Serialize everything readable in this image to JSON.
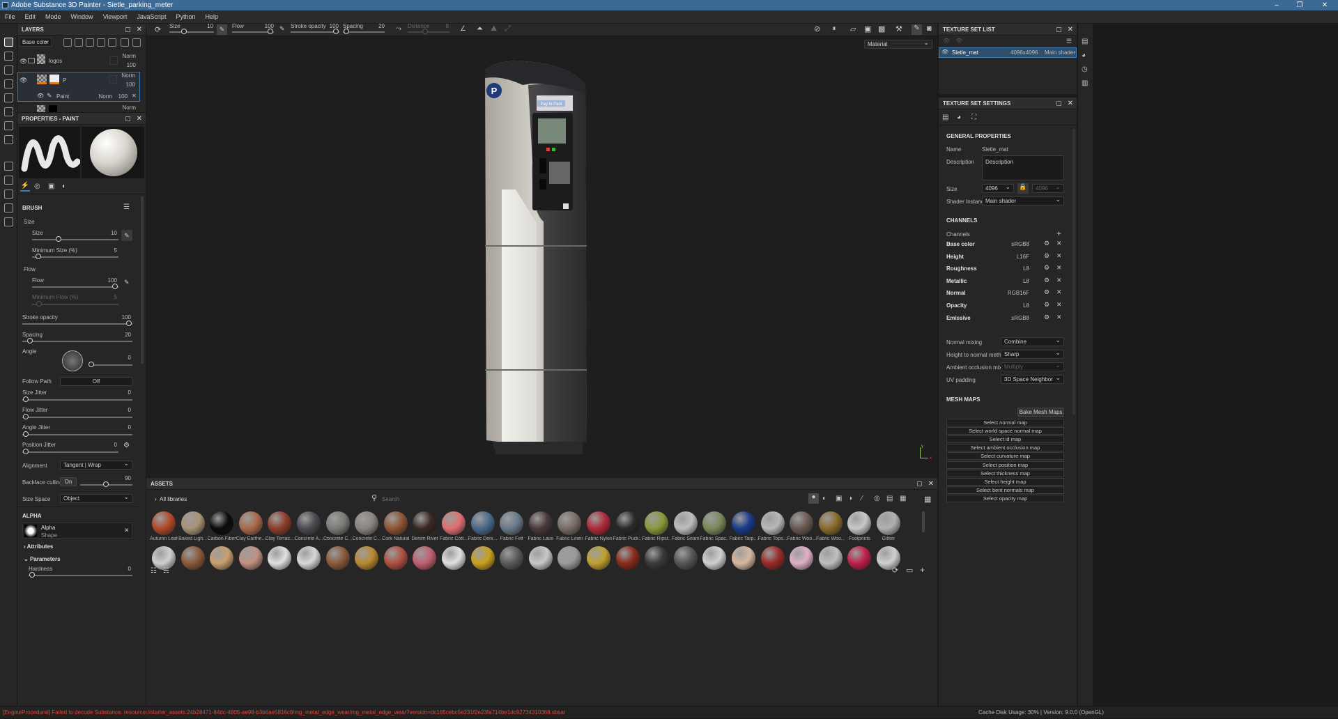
{
  "app": {
    "title": "Adobe Substance 3D Painter - Sietle_parking_meter"
  },
  "menu": [
    "File",
    "Edit",
    "Mode",
    "Window",
    "Viewport",
    "JavaScript",
    "Python",
    "Help"
  ],
  "layers": {
    "title": "LAYERS",
    "channel": "Base color",
    "items": [
      {
        "name": "logos",
        "blend": "Norm",
        "opacity": "100"
      },
      {
        "name": "P",
        "blend": "Norm",
        "opacity": "100"
      },
      {
        "name": "Paint",
        "blend": "Norm",
        "opacity": "100"
      },
      {
        "blend": "Norm"
      }
    ]
  },
  "properties": {
    "title": "PROPERTIES - PAINT",
    "brush": "BRUSH",
    "size_group": "Size",
    "size": {
      "label": "Size",
      "value": "10"
    },
    "min_size": {
      "label": "Minimum Size (%)",
      "value": "5"
    },
    "flow_group": "Flow",
    "flow": {
      "label": "Flow",
      "value": "100"
    },
    "min_flow": {
      "label": "Minimum Flow (%)",
      "value": "5"
    },
    "stroke_opacity": {
      "label": "Stroke opacity",
      "value": "100"
    },
    "spacing": {
      "label": "Spacing",
      "value": "20"
    },
    "angle": {
      "label": "Angle",
      "value": "0"
    },
    "follow_path": {
      "label": "Follow Path",
      "value": "Off"
    },
    "size_jitter": {
      "label": "Size Jitter",
      "value": "0"
    },
    "flow_jitter": {
      "label": "Flow Jitter",
      "value": "0"
    },
    "angle_jitter": {
      "label": "Angle Jitter",
      "value": "0"
    },
    "position_jitter": {
      "label": "Position Jitter",
      "value": "0"
    },
    "alignment": {
      "label": "Alignment",
      "value": "Tangent | Wrap"
    },
    "backface": {
      "label": "Backface culling",
      "toggle": "On",
      "value": "90"
    },
    "size_space": {
      "label": "Size Space",
      "value": "Object"
    },
    "alpha": "ALPHA",
    "alpha_name": "Alpha",
    "alpha_sub": "Shape",
    "attributes": "Attributes",
    "parameters": "Parameters",
    "hardness": {
      "label": "Hardness",
      "value": "0"
    }
  },
  "toolbar": {
    "size": {
      "label": "Size",
      "value": "10"
    },
    "flow": {
      "label": "Flow",
      "value": "100"
    },
    "stroke": {
      "label": "Stroke opacity",
      "value": "100"
    },
    "spacing": {
      "label": "Spacing",
      "value": "20"
    },
    "distance": {
      "label": "Distance",
      "value": "8"
    }
  },
  "viewport": {
    "mode": "Material",
    "sign": "Pay to Park",
    "logo": "P",
    "axis_x": "x",
    "axis_y": "y"
  },
  "assets": {
    "title": "ASSETS",
    "library": "All libraries",
    "search_placeholder": "Search",
    "row1": [
      "Autumn Leaf",
      "Baked Ligh...",
      "Carbon Fiber",
      "Clay Earthe...",
      "Clay Terrac...",
      "Concrete A...",
      "Concrete C...",
      "Concrete C...",
      "Cork Natural",
      "Denim Rivet",
      "Fabric Cott...",
      "Fabric Deni...",
      "Fabric Felt",
      "Fabric Lace",
      "Fabric Linen",
      "Fabric Nylon",
      "Fabric Puck...",
      "Fabric Ripst...",
      "Fabric Seam",
      "Fabric Spac...",
      "Fabric Tarp...",
      "Fabric Tops...",
      "Fabric Woo...",
      "Fabric Woo...",
      "Footprints",
      "Glitter"
    ],
    "row1_colors": [
      "#b24a2a",
      "#a89278",
      "#0c0c0c",
      "#a86a48",
      "#8e3e2a",
      "#4a4a50",
      "#7d7b78",
      "#8a8580",
      "#8d5535",
      "#3a2a22",
      "#e07070",
      "#4a6a8a",
      "#6a7a8a",
      "#4a3a3a",
      "#7a6c66",
      "#b02a3a",
      "#2a2a2a",
      "#8a9a3a",
      "#bdbdbd",
      "#7a8a5a",
      "#1a3a8a",
      "#b8b8b8",
      "#6a5a50",
      "#8a6a2a",
      "#c8c8c8",
      "#b0b0b0"
    ],
    "row2_colors": [
      "#cfcfcf",
      "#8a5a3a",
      "#c8a070",
      "#c09080",
      "#e0e0e0",
      "#d8d8d8",
      "#8a5a3a",
      "#b88a30",
      "#b05040",
      "#c06070",
      "#e0e0e0",
      "#c8a020",
      "#5a5a5a",
      "#c8c8c8",
      "#9a9a9a",
      "#c0a030",
      "#8a2a1a",
      "#3a3a3a",
      "#555555",
      "#d0d0d0",
      "#d8b8a0",
      "#9a2a2a",
      "#e0b0c8",
      "#c0c0c0",
      "#c0204a",
      "#d0d0d0"
    ]
  },
  "texture_set_list": {
    "title": "TEXTURE SET LIST",
    "name": "Sietle_mat",
    "resolution": "4096x4096",
    "shader": "Main shader"
  },
  "texture_set_settings": {
    "title": "TEXTURE SET SETTINGS",
    "general": "GENERAL PROPERTIES",
    "name_label": "Name",
    "name_value": "Sietle_mat",
    "desc_label": "Description",
    "desc_value": "Description",
    "size_label": "Size",
    "size_value": "4096",
    "size_value2": "4096",
    "shader_label": "Shader Instance",
    "shader_value": "Main shader",
    "channels_title": "CHANNELS",
    "channels_label": "Channels",
    "channels": [
      {
        "name": "Base color",
        "format": "sRGB8"
      },
      {
        "name": "Height",
        "format": "L16F"
      },
      {
        "name": "Roughness",
        "format": "L8"
      },
      {
        "name": "Metallic",
        "format": "L8"
      },
      {
        "name": "Normal",
        "format": "RGB16F"
      },
      {
        "name": "Opacity",
        "format": "L8"
      },
      {
        "name": "Emissive",
        "format": "sRGB8"
      }
    ],
    "normal_mixing": {
      "label": "Normal mixing",
      "value": "Combine"
    },
    "height_normal": {
      "label": "Height to normal method",
      "value": "Sharp"
    },
    "ao_mixing": {
      "label": "Ambient occlusion mixing",
      "value": "Multiply"
    },
    "uv_padding": {
      "label": "UV padding",
      "value": "3D Space Neighbor"
    },
    "mesh_maps": "MESH MAPS",
    "bake": "Bake Mesh Maps",
    "maps": [
      "Select normal map",
      "Select world space normal map",
      "Select id map",
      "Select ambient occlusion map",
      "Select curvature map",
      "Select position map",
      "Select thickness map",
      "Select height map",
      "Select bent normals map",
      "Select opacity map"
    ]
  },
  "status": {
    "error": "[EngineProcedural] Failed to decode Substance. resource://starter_assets.24b28471-84dc-4805-ae98-b3b6ae5816c8/mg_metal_edge_wear/mg_metal_edge_wear?version=dc165cebc5e231f2e23fa714be1dc92734310368.sbsar",
    "cache": "Cache Disk Usage:   30% | Version: 9.0.0 (OpenGL)"
  },
  "colors": {
    "accent": "#3d6a94",
    "error": "#e0463c",
    "selection": "#2f5a80"
  }
}
